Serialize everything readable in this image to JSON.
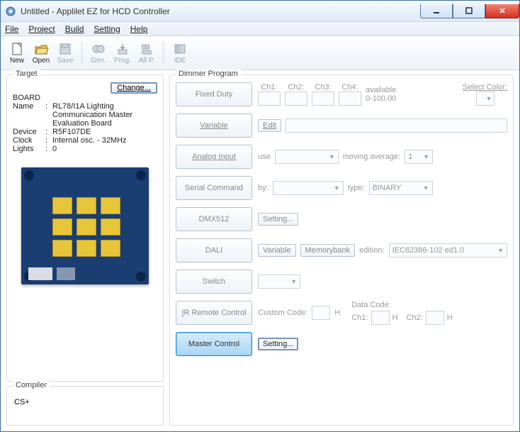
{
  "window": {
    "title": "Untitled - Applilet EZ for HCD Controller"
  },
  "menu": {
    "file": "File",
    "project": "Project",
    "build": "Build",
    "setting": "Setting",
    "help": "Help"
  },
  "toolbar": {
    "new": "New",
    "open": "Open",
    "save": "Save",
    "gen": "Gen.",
    "prog": "Prog.",
    "allp": "All P.",
    "ide": "IDE"
  },
  "target": {
    "legend": "Target",
    "change": "Change...",
    "board_hdr": "BOARD",
    "name_lbl": "Name",
    "name_val": "RL78/I1A Lighting Communication Master Evaluation Board",
    "device_lbl": "Device",
    "device_val": "R5F107DE",
    "clock_lbl": "Clock",
    "clock_val": "Internal osc. - 32MHz",
    "lights_lbl": "Lights",
    "lights_val": "0",
    "colon": ":"
  },
  "compiler": {
    "legend": "Compiler",
    "value": "CS+"
  },
  "dimmer": {
    "legend": "Dimmer Program",
    "fixed_duty": "Fixed Duty",
    "variable": "Variable",
    "analog_input": "Analog Input",
    "serial_command": "Serial Command",
    "dmx512": "DMX512",
    "dali": "DALI",
    "switch": "Switch",
    "ir_remote": "IR Remote Control",
    "master_control": "Master Control",
    "ch1": "Ch1:",
    "ch2": "Ch2:",
    "ch3": "Ch3:",
    "ch4": "Ch4:",
    "available": "available",
    "range": "0-100.00",
    "select_color": "Select Color:",
    "edit": "Edit",
    "use": "use",
    "moving_avg": "moving average:",
    "moving_avg_val": "1",
    "by": "by:",
    "type": "type:",
    "type_val": "BINARY",
    "setting": "Setting...",
    "variable_btn": "Variable",
    "memorybank": "Memorybank",
    "edition": "edition:",
    "edition_val": "IEC62386-102 ed1.0",
    "custom_code": "Custom Code:",
    "data_code": "Data Code:",
    "h": "H",
    "dc_ch1": "Ch1:",
    "dc_ch2": "Ch2:"
  }
}
